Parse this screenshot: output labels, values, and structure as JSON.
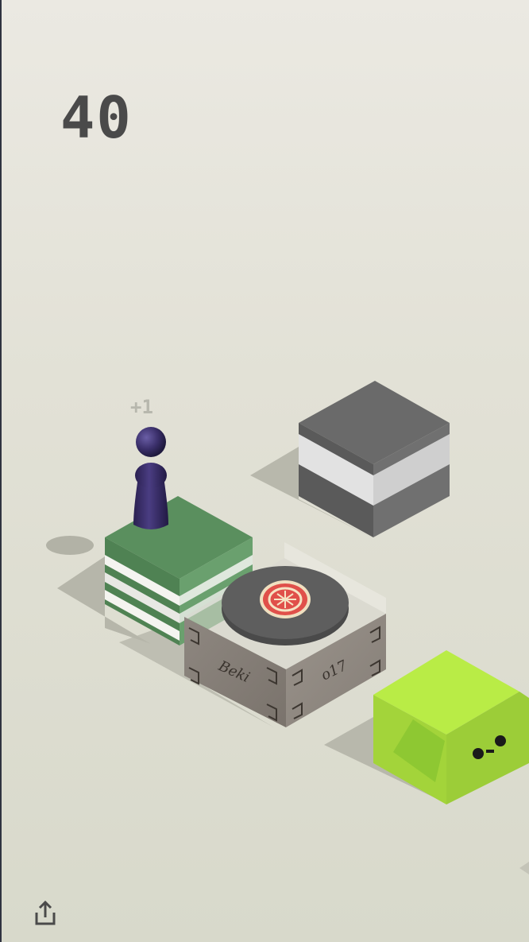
{
  "hud": {
    "score": "40",
    "bonus": "+1"
  },
  "platforms": {
    "wooden_box_left_text": "Beki",
    "wooden_box_right_text": "o17"
  },
  "icons": {
    "share": "share-icon"
  },
  "colors": {
    "background": "#e4e2d8",
    "score": "#4a4a4a",
    "green_stack": "#5a8f5e",
    "gray_cube": "#6a6a6a",
    "lime_cube": "#aee53c",
    "player": "#3a2f6a",
    "target_red": "#e0504a"
  }
}
